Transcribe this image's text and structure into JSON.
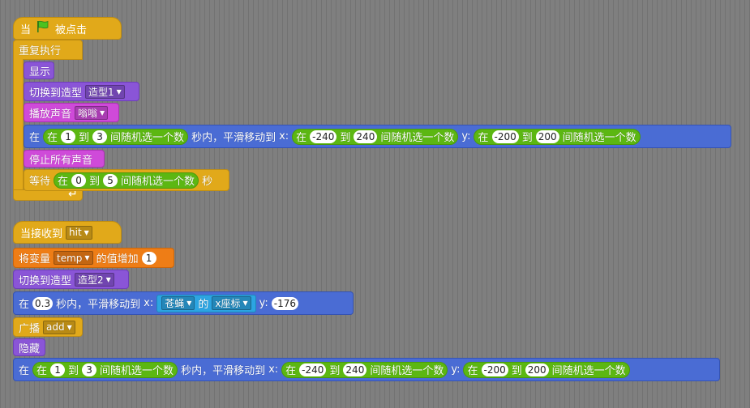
{
  "script1": {
    "hat": {
      "when": "当",
      "clicked": "被点击",
      "flag_icon": "green-flag-icon"
    },
    "forever": "重复执行",
    "show": "显示",
    "switch_costume": {
      "label": "切换到造型",
      "costume": "造型1"
    },
    "play_sound": {
      "label": "播放声音",
      "sound": "嗡嗡"
    },
    "glide": {
      "in": "在",
      "secs": "秒内，平滑移动到",
      "x_label": "x:",
      "y_label": "y:",
      "rand_secs": {
        "in": "在",
        "from": "1",
        "to_word": "到",
        "to": "3",
        "suffix": "间随机选一个数"
      },
      "rand_x": {
        "in": "在",
        "from": "-240",
        "to_word": "到",
        "to": "240",
        "suffix": "间随机选一个数"
      },
      "rand_y": {
        "in": "在",
        "from": "-200",
        "to_word": "到",
        "to": "200",
        "suffix": "间随机选一个数"
      }
    },
    "stop_sounds": "停止所有声音",
    "wait": {
      "label": "等待",
      "secs": "秒",
      "rand": {
        "in": "在",
        "from": "0",
        "to_word": "到",
        "to": "5",
        "suffix": "间随机选一个数"
      }
    }
  },
  "script2": {
    "hat": {
      "label": "当接收到",
      "message": "hit"
    },
    "change_var": {
      "label": "将变量",
      "var": "temp",
      "suffix": "的值增加",
      "value": "1"
    },
    "switch_costume": {
      "label": "切换到造型",
      "costume": "造型2"
    },
    "glide": {
      "in": "在",
      "secs_value": "0.3",
      "secs": "秒内，平滑移动到",
      "x_label": "x:",
      "sprite": "苍蝇",
      "of": "的",
      "attr": "x座标",
      "y_label": "y:",
      "y_value": "-176"
    },
    "broadcast": {
      "label": "广播",
      "message": "add"
    },
    "hide": "隐藏",
    "glide2": {
      "in": "在",
      "secs": "秒内，平滑移动到",
      "x_label": "x:",
      "y_label": "y:",
      "rand_secs": {
        "in": "在",
        "from": "1",
        "to_word": "到",
        "to": "3",
        "suffix": "间随机选一个数"
      },
      "rand_x": {
        "in": "在",
        "from": "-240",
        "to_word": "到",
        "to": "240",
        "suffix": "间随机选一个数"
      },
      "rand_y": {
        "in": "在",
        "from": "-200",
        "to_word": "到",
        "to": "200",
        "suffix": "间随机选一个数"
      }
    }
  },
  "colors": {
    "background": "#7f7f7f",
    "control": "#e1a91a",
    "looks": "#8a55d7",
    "sound": "#cf4ad9",
    "motion": "#4a6cd4",
    "operators": "#5cb712",
    "data": "#ee7d16",
    "events": "#c88330",
    "sensing": "#2ca5e2"
  }
}
